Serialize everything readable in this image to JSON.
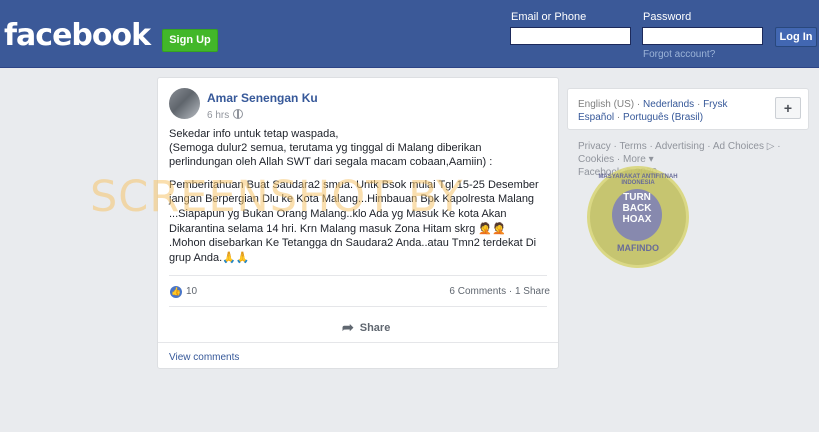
{
  "header": {
    "logo": "facebook",
    "signup_label": "Sign Up",
    "email_label": "Email or Phone",
    "password_label": "Password",
    "login_label": "Log In",
    "forgot_label": "Forgot account?"
  },
  "post": {
    "author": "Amar Senengan Ku",
    "time": "6 hrs",
    "lines": [
      "Sekedar info untuk tetap waspada,",
      "(Semoga dulur2 semua, terutama yg tinggal di Malang diberikan",
      "perlindungan oleh Allah SWT dari segala macam cobaan,Aamiin) :",
      "Pemberitahuan Buat Saudara2 smua. Untk Bsok mulai Tgl 15-25 Desember",
      "jangan Berpergian Dlu ke Kota Malang...Himbauan Bpk Kapolresta Malang",
      "...Siapapun yg Bukan Orang Malang..klo Ada yg Masuk Ke kota Akan",
      "Dikarantina selama 14 hri. Krn Malang masuk Zona Hitam skrg",
      ".Mohon disebarkan Ke Tetangga dn Saudara2 Anda..atau Tmn2 terdekat Di",
      "grup Anda."
    ],
    "emoji_men": "🤦🤦",
    "emoji_hands": "🙏🙏",
    "like_count": "10",
    "comments": "6 Comments",
    "shares": "1 Share",
    "share_label": "Share",
    "view_comments": "View comments"
  },
  "sidebar": {
    "languages": [
      "English (US)",
      "Nederlands",
      "Frysk",
      "Español",
      "Português (Brasil)"
    ],
    "footer_line1": "Privacy · Terms · Advertising · Ad Choices ▷ ·",
    "footer_line2": "Cookies · More ▾",
    "footer_line3": "Facebook © 2020"
  },
  "overlays": {
    "watermark": "SCREENSHOT BY",
    "badge_inner": "TURN BACK HOAX",
    "badge_bottom": "MAFINDO",
    "badge_top": "MASYARAKAT ANTIFITNAH INDONESIA"
  },
  "colors": {
    "brand_blue": "#3b5998",
    "signup_green": "#42b72a",
    "link_blue": "#365899"
  }
}
